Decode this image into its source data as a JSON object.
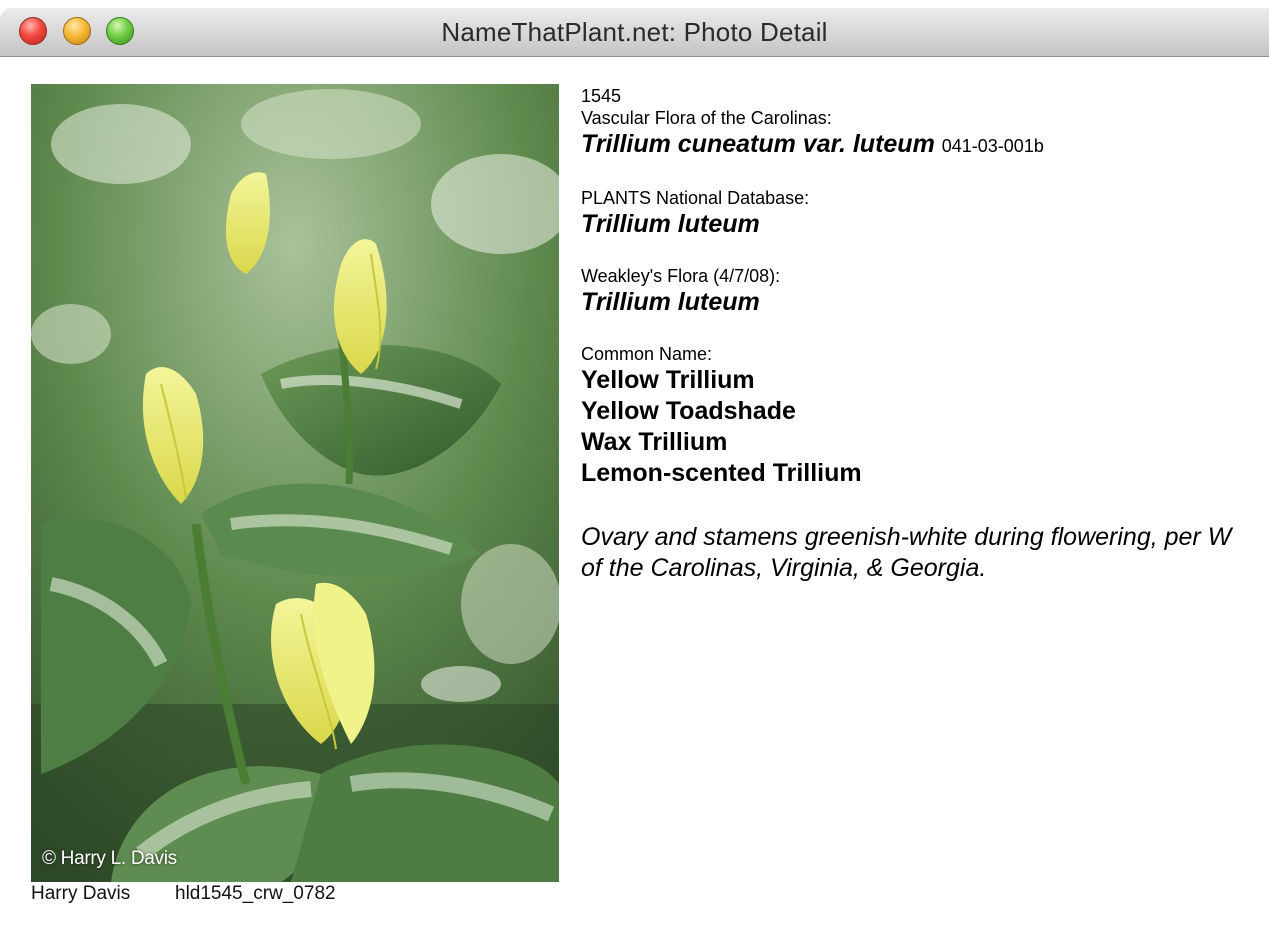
{
  "window": {
    "title": "NameThatPlant.net: Photo Detail"
  },
  "photo": {
    "description_icon": "trillium-photo",
    "copyright": "© Harry L. Davis",
    "photographer": "Harry Davis",
    "filename": "hld1545_crw_0782"
  },
  "info": {
    "id": "1545",
    "vascular_label": "Vascular Flora of the Carolinas:",
    "vascular_name": "Trillium cuneatum var. luteum",
    "vascular_code": "041-03-001b",
    "plants_label": "PLANTS National Database:",
    "plants_name": "Trillium luteum",
    "weakley_label": "Weakley's Flora (4/7/08):",
    "weakley_name": "Trillium luteum",
    "common_label": "Common Name:",
    "common_names": [
      "Yellow Trillium",
      "Yellow Toadshade",
      "Wax Trillium",
      "Lemon-scented Trillium"
    ],
    "note_line1": "Ovary and stamens greenish-white during flowering, per W",
    "note_line2": "of the Carolinas, Virginia, & Georgia."
  }
}
